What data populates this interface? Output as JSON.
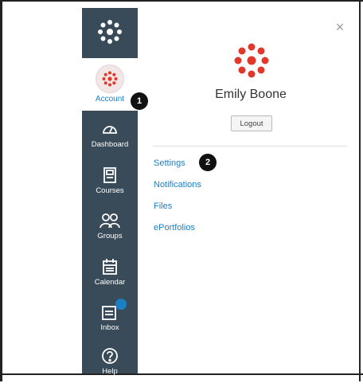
{
  "window": {
    "close_glyph": "×"
  },
  "sidebar": {
    "logo_icon": "canvas-logo-icon",
    "account": {
      "label": "Account",
      "icon": "user-avatar-canvas-icon"
    },
    "items": [
      {
        "label": "Dashboard",
        "icon": "dashboard-icon"
      },
      {
        "label": "Courses",
        "icon": "courses-icon"
      },
      {
        "label": "Groups",
        "icon": "groups-icon"
      },
      {
        "label": "Calendar",
        "icon": "calendar-icon"
      },
      {
        "label": "Inbox",
        "icon": "inbox-icon",
        "badge": ""
      },
      {
        "label": "Help",
        "icon": "help-icon"
      }
    ]
  },
  "account_tray": {
    "user_name": "Emily Boone",
    "logout_label": "Logout",
    "links": [
      {
        "label": "Settings"
      },
      {
        "label": "Notifications"
      },
      {
        "label": "Files"
      },
      {
        "label": "ePortfolios"
      }
    ]
  },
  "callouts": [
    "1",
    "2"
  ],
  "colors": {
    "sidebar_bg": "#394b58",
    "link": "#1b7fc4",
    "brand_red": "#e0382a"
  }
}
